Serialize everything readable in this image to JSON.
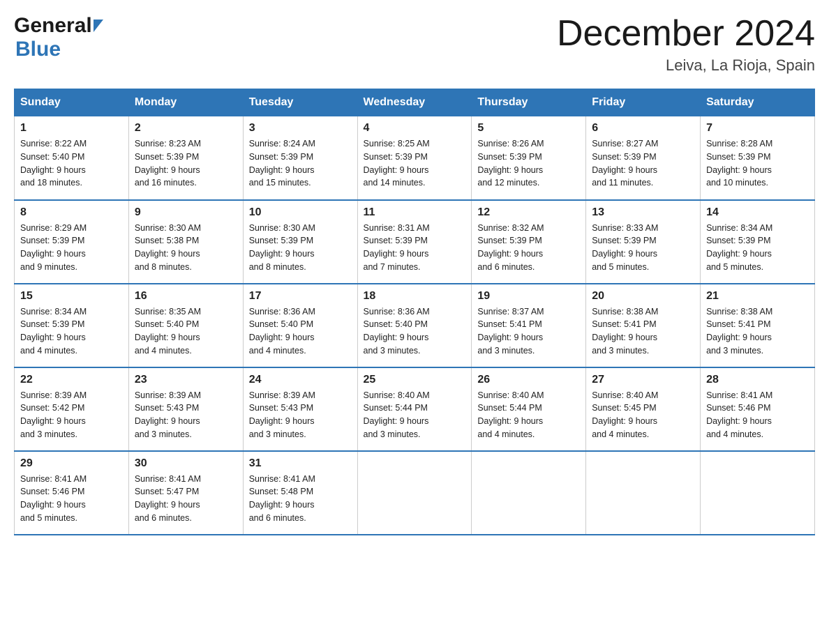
{
  "header": {
    "logo_general": "General",
    "logo_blue": "Blue",
    "month_title": "December 2024",
    "location": "Leiva, La Rioja, Spain"
  },
  "days_of_week": [
    "Sunday",
    "Monday",
    "Tuesday",
    "Wednesday",
    "Thursday",
    "Friday",
    "Saturday"
  ],
  "weeks": [
    [
      {
        "day": "1",
        "sunrise": "8:22 AM",
        "sunset": "5:40 PM",
        "daylight": "9 hours and 18 minutes."
      },
      {
        "day": "2",
        "sunrise": "8:23 AM",
        "sunset": "5:39 PM",
        "daylight": "9 hours and 16 minutes."
      },
      {
        "day": "3",
        "sunrise": "8:24 AM",
        "sunset": "5:39 PM",
        "daylight": "9 hours and 15 minutes."
      },
      {
        "day": "4",
        "sunrise": "8:25 AM",
        "sunset": "5:39 PM",
        "daylight": "9 hours and 14 minutes."
      },
      {
        "day": "5",
        "sunrise": "8:26 AM",
        "sunset": "5:39 PM",
        "daylight": "9 hours and 12 minutes."
      },
      {
        "day": "6",
        "sunrise": "8:27 AM",
        "sunset": "5:39 PM",
        "daylight": "9 hours and 11 minutes."
      },
      {
        "day": "7",
        "sunrise": "8:28 AM",
        "sunset": "5:39 PM",
        "daylight": "9 hours and 10 minutes."
      }
    ],
    [
      {
        "day": "8",
        "sunrise": "8:29 AM",
        "sunset": "5:39 PM",
        "daylight": "9 hours and 9 minutes."
      },
      {
        "day": "9",
        "sunrise": "8:30 AM",
        "sunset": "5:38 PM",
        "daylight": "9 hours and 8 minutes."
      },
      {
        "day": "10",
        "sunrise": "8:30 AM",
        "sunset": "5:39 PM",
        "daylight": "9 hours and 8 minutes."
      },
      {
        "day": "11",
        "sunrise": "8:31 AM",
        "sunset": "5:39 PM",
        "daylight": "9 hours and 7 minutes."
      },
      {
        "day": "12",
        "sunrise": "8:32 AM",
        "sunset": "5:39 PM",
        "daylight": "9 hours and 6 minutes."
      },
      {
        "day": "13",
        "sunrise": "8:33 AM",
        "sunset": "5:39 PM",
        "daylight": "9 hours and 5 minutes."
      },
      {
        "day": "14",
        "sunrise": "8:34 AM",
        "sunset": "5:39 PM",
        "daylight": "9 hours and 5 minutes."
      }
    ],
    [
      {
        "day": "15",
        "sunrise": "8:34 AM",
        "sunset": "5:39 PM",
        "daylight": "9 hours and 4 minutes."
      },
      {
        "day": "16",
        "sunrise": "8:35 AM",
        "sunset": "5:40 PM",
        "daylight": "9 hours and 4 minutes."
      },
      {
        "day": "17",
        "sunrise": "8:36 AM",
        "sunset": "5:40 PM",
        "daylight": "9 hours and 4 minutes."
      },
      {
        "day": "18",
        "sunrise": "8:36 AM",
        "sunset": "5:40 PM",
        "daylight": "9 hours and 3 minutes."
      },
      {
        "day": "19",
        "sunrise": "8:37 AM",
        "sunset": "5:41 PM",
        "daylight": "9 hours and 3 minutes."
      },
      {
        "day": "20",
        "sunrise": "8:38 AM",
        "sunset": "5:41 PM",
        "daylight": "9 hours and 3 minutes."
      },
      {
        "day": "21",
        "sunrise": "8:38 AM",
        "sunset": "5:41 PM",
        "daylight": "9 hours and 3 minutes."
      }
    ],
    [
      {
        "day": "22",
        "sunrise": "8:39 AM",
        "sunset": "5:42 PM",
        "daylight": "9 hours and 3 minutes."
      },
      {
        "day": "23",
        "sunrise": "8:39 AM",
        "sunset": "5:43 PM",
        "daylight": "9 hours and 3 minutes."
      },
      {
        "day": "24",
        "sunrise": "8:39 AM",
        "sunset": "5:43 PM",
        "daylight": "9 hours and 3 minutes."
      },
      {
        "day": "25",
        "sunrise": "8:40 AM",
        "sunset": "5:44 PM",
        "daylight": "9 hours and 3 minutes."
      },
      {
        "day": "26",
        "sunrise": "8:40 AM",
        "sunset": "5:44 PM",
        "daylight": "9 hours and 4 minutes."
      },
      {
        "day": "27",
        "sunrise": "8:40 AM",
        "sunset": "5:45 PM",
        "daylight": "9 hours and 4 minutes."
      },
      {
        "day": "28",
        "sunrise": "8:41 AM",
        "sunset": "5:46 PM",
        "daylight": "9 hours and 4 minutes."
      }
    ],
    [
      {
        "day": "29",
        "sunrise": "8:41 AM",
        "sunset": "5:46 PM",
        "daylight": "9 hours and 5 minutes."
      },
      {
        "day": "30",
        "sunrise": "8:41 AM",
        "sunset": "5:47 PM",
        "daylight": "9 hours and 6 minutes."
      },
      {
        "day": "31",
        "sunrise": "8:41 AM",
        "sunset": "5:48 PM",
        "daylight": "9 hours and 6 minutes."
      },
      null,
      null,
      null,
      null
    ]
  ],
  "labels": {
    "sunrise": "Sunrise:",
    "sunset": "Sunset:",
    "daylight": "Daylight:"
  }
}
